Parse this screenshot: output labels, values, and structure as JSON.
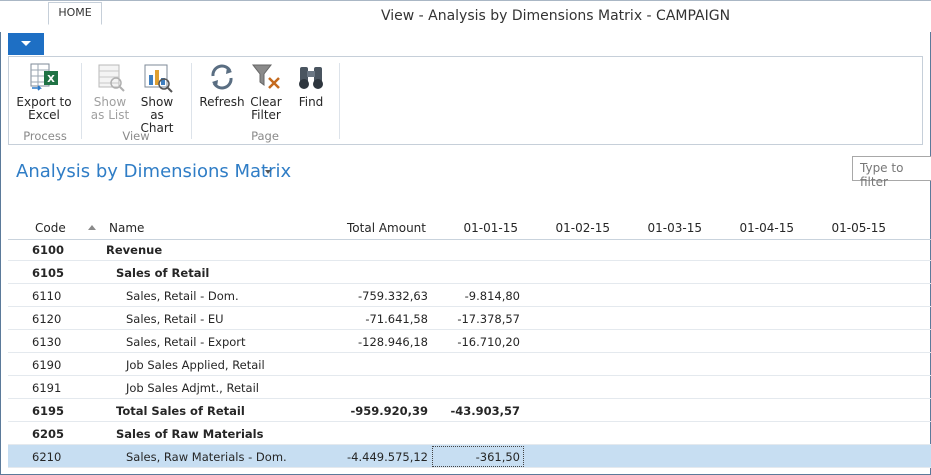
{
  "window": {
    "title": "View - Analysis by Dimensions Matrix - CAMPAIGN"
  },
  "ribbon": {
    "tab": "HOME",
    "buttons": {
      "export_excel": "Export to Excel",
      "show_list": "Show as List",
      "show_chart": "Show as Chart",
      "refresh": "Refresh",
      "clear_filter": "Clear Filter",
      "find": "Find"
    },
    "groups": {
      "process": "Process",
      "view": "View",
      "page": "Page"
    }
  },
  "page": {
    "title": "Analysis by Dimensions Matrix",
    "filter_placeholder": "Type to filter"
  },
  "table": {
    "headers": {
      "code": "Code",
      "name": "Name",
      "total": "Total Amount",
      "p1": "01-01-15",
      "p2": "01-02-15",
      "p3": "01-03-15",
      "p4": "01-04-15",
      "p5": "01-05-15"
    },
    "rows": [
      {
        "code": "6100",
        "name": "Revenue",
        "total": "",
        "p1": ""
      },
      {
        "code": "6105",
        "name": "Sales of Retail",
        "total": "",
        "p1": ""
      },
      {
        "code": "6110",
        "name": "Sales, Retail - Dom.",
        "total": "-759.332,63",
        "p1": "-9.814,80"
      },
      {
        "code": "6120",
        "name": "Sales, Retail - EU",
        "total": "-71.641,58",
        "p1": "-17.378,57"
      },
      {
        "code": "6130",
        "name": "Sales, Retail - Export",
        "total": "-128.946,18",
        "p1": "-16.710,20"
      },
      {
        "code": "6190",
        "name": "Job Sales Applied, Retail",
        "total": "",
        "p1": ""
      },
      {
        "code": "6191",
        "name": "Job Sales Adjmt., Retail",
        "total": "",
        "p1": ""
      },
      {
        "code": "6195",
        "name": "Total Sales of Retail",
        "total": "-959.920,39",
        "p1": "-43.903,57"
      },
      {
        "code": "6205",
        "name": "Sales of Raw Materials",
        "total": "",
        "p1": ""
      },
      {
        "code": "6210",
        "name": "Sales, Raw Materials - Dom.",
        "total": "-4.449.575,12",
        "p1": "-361,50"
      }
    ]
  }
}
